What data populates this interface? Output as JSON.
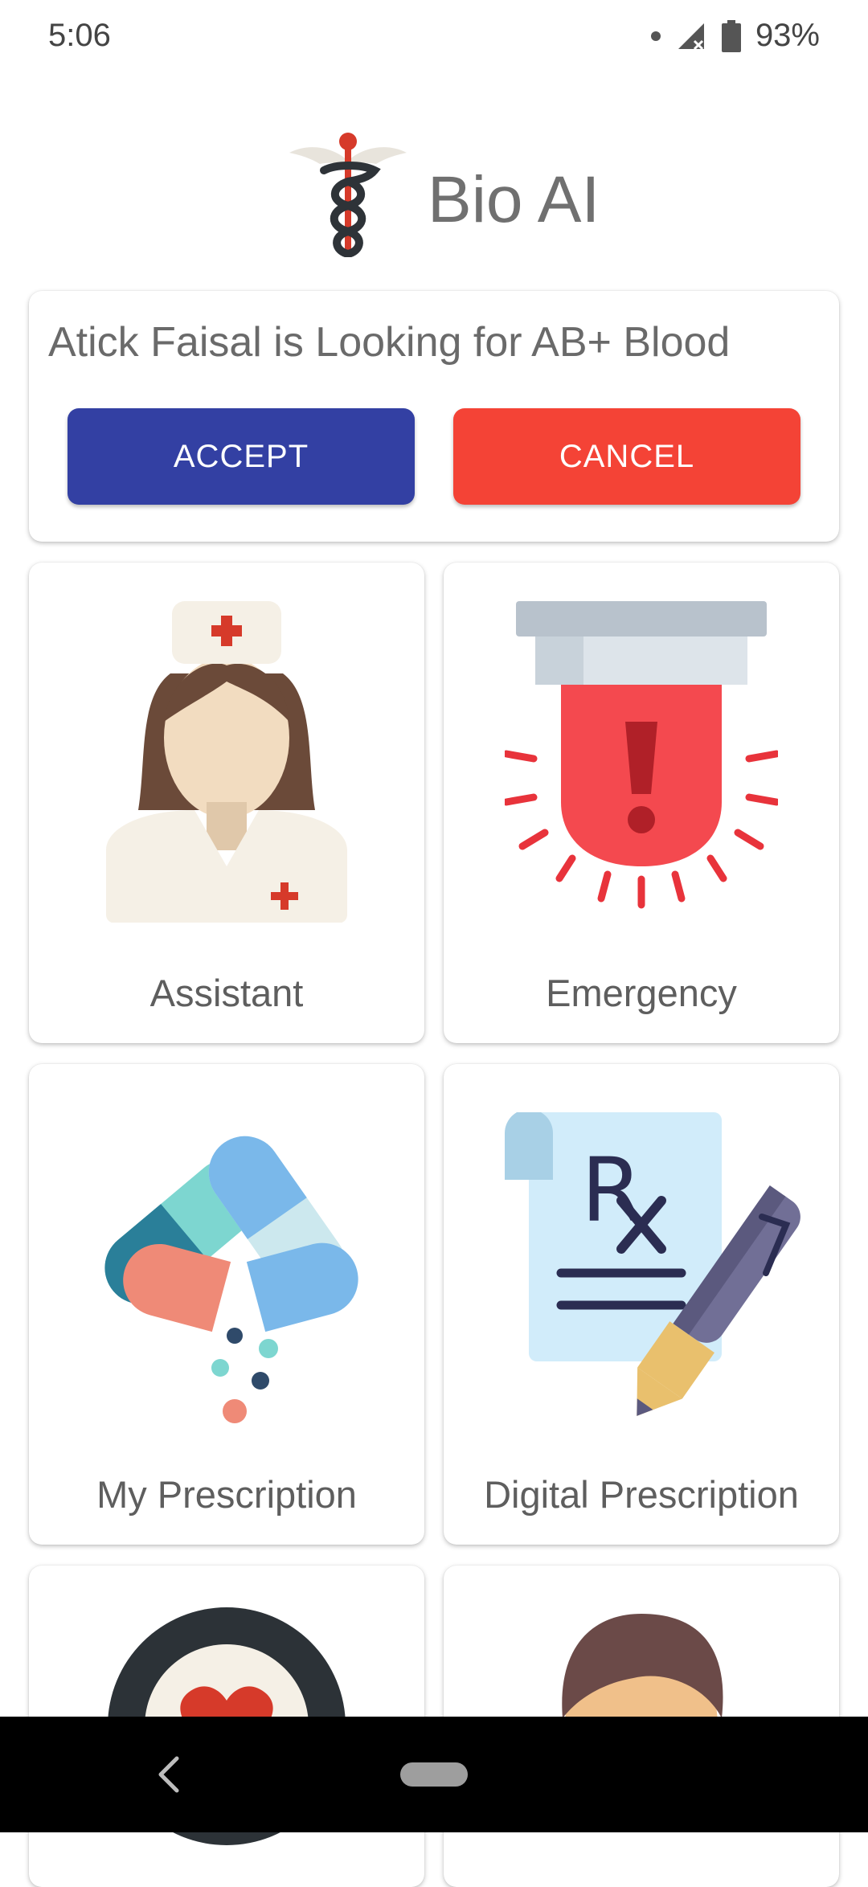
{
  "status": {
    "time": "5:06",
    "battery": "93%"
  },
  "header": {
    "title": "Bio AI"
  },
  "request": {
    "message": "Atick Faisal is Looking for AB+ Blood",
    "accept_label": "ACCEPT",
    "cancel_label": "CANCEL"
  },
  "tiles": [
    {
      "label": "Assistant",
      "icon": "nurse-icon"
    },
    {
      "label": "Emergency",
      "icon": "siren-icon"
    },
    {
      "label": "My Prescription",
      "icon": "pills-icon"
    },
    {
      "label": "Digital Prescription",
      "icon": "rx-pen-icon"
    },
    {
      "label": "",
      "icon": "heart-target-icon"
    },
    {
      "label": "",
      "icon": "doctor-avatar-icon"
    }
  ]
}
